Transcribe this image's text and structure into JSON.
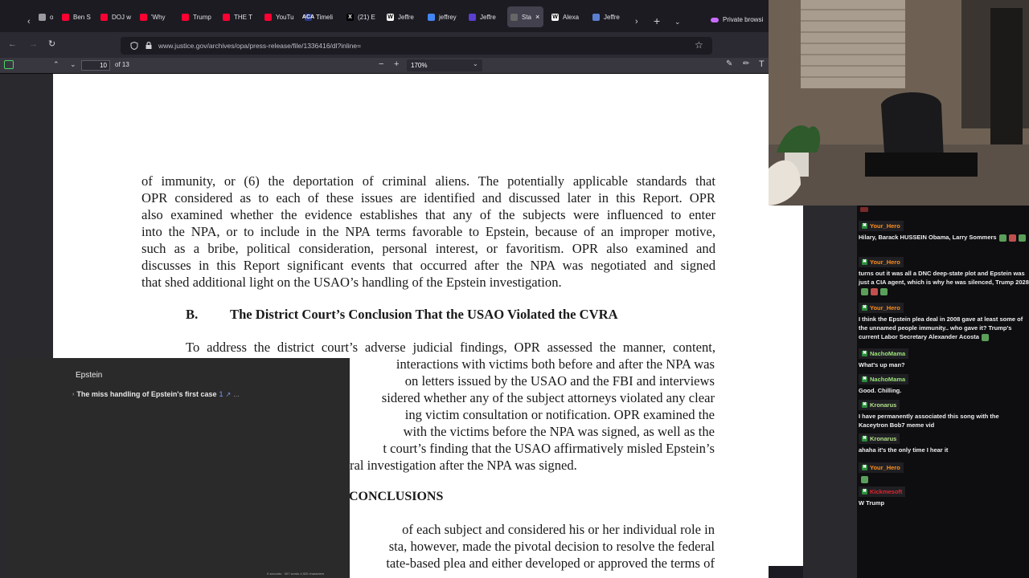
{
  "browser": {
    "tabs": [
      {
        "label": "orld",
        "color": "#9a9aa0"
      },
      {
        "label": "Ben S",
        "color": "#ff0033"
      },
      {
        "label": "DOJ w",
        "color": "#ff0033"
      },
      {
        "label": "'Why",
        "color": "#ff0033"
      },
      {
        "label": "Trump",
        "color": "#ff0033"
      },
      {
        "label": "THE T",
        "color": "#ff0033"
      },
      {
        "label": "YouTu",
        "color": "#ff0033"
      },
      {
        "label": "Timeli",
        "color": "#2a3a8c",
        "fav": "ACA"
      },
      {
        "label": "(21) E",
        "color": "#000000",
        "fav": "X"
      },
      {
        "label": "Jeffre",
        "color": "#ffffff",
        "fav": "W"
      },
      {
        "label": "jeffrey",
        "color": "#4285f4"
      },
      {
        "label": "Jeffre",
        "color": "#5a3fd0"
      },
      {
        "label": "Sta",
        "color": "#666666",
        "active": true
      },
      {
        "label": "Alexa",
        "color": "#ffffff",
        "fav": "W"
      },
      {
        "label": "Jeffre",
        "color": "#5a7fd0"
      }
    ],
    "private_label": "Private browsi",
    "url": "www.justice.gov/archives/opa/press-release/file/1336416/dl?inline="
  },
  "pdf_toolbar": {
    "page_number": "10",
    "page_total": "of 13",
    "zoom": "170%"
  },
  "document": {
    "para1": [
      "of immunity, or (6) the deportation of criminal aliens.  The potentially applicable standards that",
      "OPR considered as to each of these issues are identified and discussed later in this Report.  OPR",
      "also examined whether the evidence establishes that any of the subjects were influenced to enter",
      "into the NPA, or to include in the NPA terms favorable to Epstein, because of an improper motive,",
      "such as a bribe, political consideration, personal interest, or favoritism.  OPR also examined and",
      "discusses in this Report significant events that occurred after the NPA was negotiated and signed",
      "that shed additional light on the USAO’s handling of the Epstein investigation."
    ],
    "heading_b_letter": "B.",
    "heading_b_text": "The District Court’s Conclusion That the USAO Violated the CVRA",
    "para2_first": "To address the district court’s adverse judicial findings, OPR assessed the manner, content,",
    "para2_partial": [
      "interactions with victims both before and after the NPA was",
      "on letters issued by the USAO and the FBI and interviews",
      "sidered whether any of the subject attorneys violated any clear",
      "ing victim consultation or notification.  OPR examined the",
      "with the victims before the NPA was signed, as well as the",
      "t court’s finding that the USAO affirmatively misled Epstein’s",
      "ral investigation after the NPA was signed."
    ],
    "conclusions_heading": "CONCLUSIONS",
    "para3_partial": [
      "of each subject and considered his or her individual role in",
      "sta, however, made the pivotal decision to resolve the federal",
      "tate-based plea and either developed or approved the terms of"
    ]
  },
  "notes_panel": {
    "title": "Epstein",
    "item": "The miss handling of Epstein's first case",
    "item_link": "1",
    "item_more": "...",
    "status": "0 seconds  ·  307 words  4,920 characters"
  },
  "chat": {
    "messages": [
      {
        "user": "Your_Hero",
        "user_color": "#ff8c1a",
        "text": "Hilary, Barack HUSSEIN Obama, Larry Sommers",
        "emotes": 3
      },
      {
        "user": "Your_Hero",
        "user_color": "#ff8c1a",
        "text": "turns out it was all a DNC deep-state plot and Epstein was just a CIA agent, which is why he was silenced, Trump 2028",
        "emotes": 3
      },
      {
        "user": "Your_Hero",
        "user_color": "#ff8c1a",
        "text": "I think the Epstein plea deal in 2008 gave at least some of the unnamed people immunity.. who gave it? Trump's current Labor Secretary Alexander Acosta",
        "emotes": 1
      },
      {
        "user": "NachoMama",
        "user_color": "#9ae27a",
        "text": "What's up man?",
        "emotes": 0
      },
      {
        "user": "NachoMama",
        "user_color": "#9ae27a",
        "text": "Good. Chilling.",
        "emotes": 0
      },
      {
        "user": "Kronarus",
        "user_color": "#b4e08a",
        "text": "I have permanently associated this song with the Kaceytron Bob7 meme vid",
        "emotes": 0
      },
      {
        "user": "Kronarus",
        "user_color": "#b4e08a",
        "text": "ahaha it's the only time I hear it",
        "emotes": 0
      },
      {
        "user": "Your_Hero",
        "user_color": "#ff8c1a",
        "text": "",
        "emotes": 1
      },
      {
        "user": "Kickmesoft",
        "user_color": "#e0242b",
        "text": "W Trump",
        "emotes": 0
      }
    ]
  }
}
